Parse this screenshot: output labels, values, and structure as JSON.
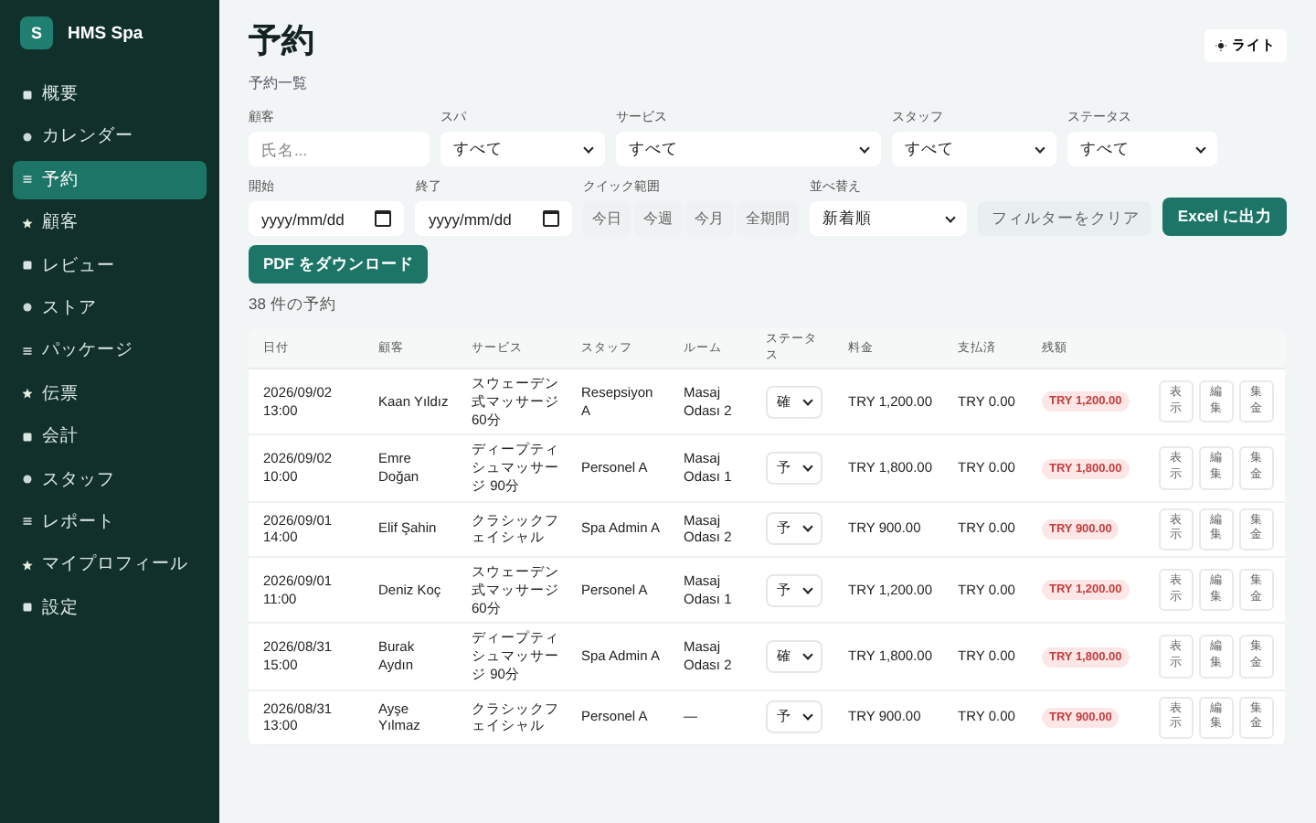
{
  "brand": {
    "initial": "S",
    "name": "HMS Spa"
  },
  "sidebar": {
    "items": [
      {
        "label": "概要",
        "selected": false
      },
      {
        "label": "カレンダー",
        "selected": false
      },
      {
        "label": "予約",
        "selected": true
      },
      {
        "label": "顧客",
        "selected": false
      },
      {
        "label": "レビュー",
        "selected": false
      },
      {
        "label": "ストア",
        "selected": false
      },
      {
        "label": "パッケージ",
        "selected": false
      },
      {
        "label": "伝票",
        "selected": false
      },
      {
        "label": "会計",
        "selected": false
      },
      {
        "label": "スタッフ",
        "selected": false
      },
      {
        "label": "レポート",
        "selected": false
      },
      {
        "label": "マイプロフィール",
        "selected": false
      },
      {
        "label": "設定",
        "selected": false
      }
    ]
  },
  "header": {
    "title": "予約",
    "subtitle": "予約一覧",
    "theme_button": "ライト"
  },
  "filters": {
    "customer": {
      "label": "顧客",
      "placeholder": "氏名..."
    },
    "spa": {
      "label": "スパ",
      "value": "すべて"
    },
    "service": {
      "label": "サービス",
      "value": "すべて"
    },
    "staff": {
      "label": "スタッフ",
      "value": "すべて"
    },
    "status": {
      "label": "ステータス",
      "value": "すべて"
    },
    "start": {
      "label": "開始",
      "placeholder": "yyyy/mm/dd"
    },
    "end": {
      "label": "終了",
      "placeholder": "yyyy/mm/dd"
    },
    "quick_range": {
      "label": "クイック範囲",
      "options": [
        "今日",
        "今週",
        "今月",
        "全期間"
      ]
    },
    "sort": {
      "label": "並べ替え",
      "value": "新着順"
    },
    "clear_button": "フィルターをクリア",
    "excel_button": "Excel に出力"
  },
  "pdf_button": "PDF をダウンロード",
  "count": "38 件の予約",
  "table": {
    "columns": [
      "日付",
      "顧客",
      "サービス",
      "スタッフ",
      "ルーム",
      "ステータス",
      "料金",
      "支払済",
      "残額"
    ],
    "rows": [
      {
        "date": "2026/09/02 13:00",
        "customer": "Kaan Yıldız",
        "service": "スウェーデン式マッサージ 60分",
        "staff": "Resepsiyon A",
        "room": "Masaj Odası 2",
        "status": "確",
        "fee": "TRY 1,200.00",
        "paid": "TRY 0.00",
        "balance": "TRY 1,200.00",
        "actions": [
          "表示",
          "編集",
          "集金"
        ]
      },
      {
        "date": "2026/09/02 10:00",
        "customer": "Emre Doğan",
        "service": "ディープティシュマッサージ 90分",
        "staff": "Personel A",
        "room": "Masaj Odası 1",
        "status": "予",
        "fee": "TRY 1,800.00",
        "paid": "TRY 0.00",
        "balance": "TRY 1,800.00",
        "actions": [
          "表示",
          "編集",
          "集金"
        ]
      },
      {
        "date": "2026/09/01 14:00",
        "customer": "Elif Şahin",
        "service": "クラシックフェイシャル",
        "staff": "Spa Admin A",
        "room": "Masaj Odası 2",
        "status": "予",
        "fee": "TRY 900.00",
        "paid": "TRY 0.00",
        "balance": "TRY 900.00",
        "actions": [
          "表示",
          "編集",
          "集金"
        ]
      },
      {
        "date": "2026/09/01 11:00",
        "customer": "Deniz Koç",
        "service": "スウェーデン式マッサージ 60分",
        "staff": "Personel A",
        "room": "Masaj Odası 1",
        "status": "予",
        "fee": "TRY 1,200.00",
        "paid": "TRY 0.00",
        "balance": "TRY 1,200.00",
        "actions": [
          "表示",
          "編集",
          "集金"
        ]
      },
      {
        "date": "2026/08/31 15:00",
        "customer": "Burak Aydın",
        "service": "ディープティシュマッサージ 90分",
        "staff": "Spa Admin A",
        "room": "Masaj Odası 2",
        "status": "確",
        "fee": "TRY 1,800.00",
        "paid": "TRY 0.00",
        "balance": "TRY 1,800.00",
        "actions": [
          "表示",
          "編集",
          "集金"
        ]
      },
      {
        "date": "2026/08/31 13:00",
        "customer": "Ayşe Yılmaz",
        "service": "クラシックフェイシャル",
        "staff": "Personel A",
        "room": "—",
        "status": "予",
        "fee": "TRY 900.00",
        "paid": "TRY 0.00",
        "balance": "TRY 900.00",
        "actions": [
          "表示",
          "編集",
          "集金"
        ]
      }
    ]
  }
}
